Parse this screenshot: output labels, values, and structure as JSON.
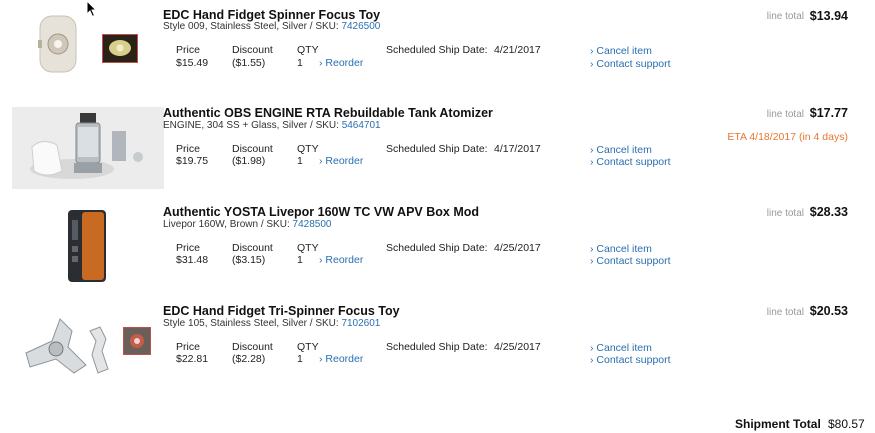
{
  "labels": {
    "price": "Price",
    "discount": "Discount",
    "qty": "QTY",
    "reorder": "› Reorder",
    "scheduled_ship": "Scheduled Ship Date:",
    "cancel": "› Cancel item",
    "contact": "› Contact support",
    "line_total": "line total",
    "sku_prefix": "SKU:"
  },
  "items": [
    {
      "title": "EDC Hand Fidget Spinner Focus Toy",
      "options": "Style 009, Stainless Steel, Silver /",
      "sku": "7426500",
      "price": "$15.49",
      "discount": "($1.55)",
      "qty": "1",
      "ship_date": "4/21/2017",
      "line_total": "$13.94",
      "eta": ""
    },
    {
      "title": "Authentic OBS ENGINE RTA Rebuildable Tank Atomizer",
      "options": "ENGINE, 304 SS + Glass, Silver /",
      "sku": "5464701",
      "price": "$19.75",
      "discount": "($1.98)",
      "qty": "1",
      "ship_date": "4/17/2017",
      "line_total": "$17.77",
      "eta": "ETA 4/18/2017 (in 4 days)"
    },
    {
      "title": "Authentic YOSTA Livepor 160W TC VW APV Box Mod",
      "options": "Livepor 160W, Brown /",
      "sku": "7428500",
      "price": "$31.48",
      "discount": "($3.15)",
      "qty": "1",
      "ship_date": "4/25/2017",
      "line_total": "$28.33",
      "eta": ""
    },
    {
      "title": "EDC Hand Fidget Tri-Spinner Focus Toy",
      "options": "Style 105, Stainless Steel, Silver /",
      "sku": "7102601",
      "price": "$22.81",
      "discount": "($2.28)",
      "qty": "1",
      "ship_date": "4/25/2017",
      "line_total": "$20.53",
      "eta": ""
    }
  ],
  "shipment": {
    "label": "Shipment Total",
    "value": "$80.57"
  },
  "colors": {
    "link": "#2a6fb0",
    "eta": "#e87732"
  }
}
